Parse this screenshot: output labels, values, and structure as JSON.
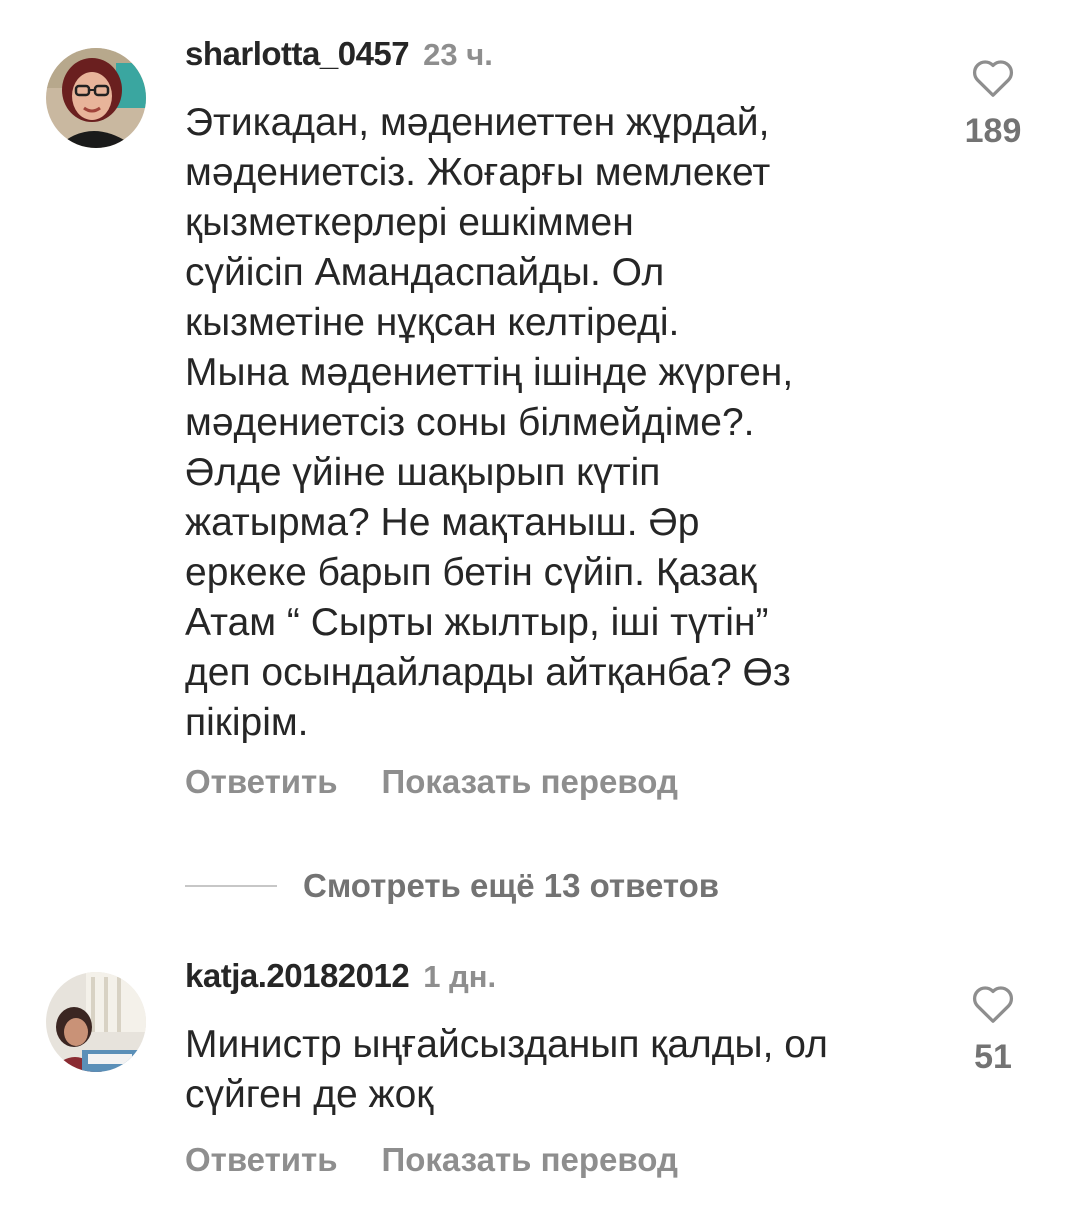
{
  "comments": [
    {
      "username": "sharlotta_0457",
      "time": "23 ч.",
      "text": "Этикадан, мәдениеттен жұрдай,\nмәдениетсіз. Жоғарғы мемлекет\nқызметкерлері ешкіммен\nсүйісіп Амандаспайды. Ол\nкызметіне нұқсан келтіреді.\nМына мәдениеттің ішінде жүрген,\nмәдениетсіз соны білмейдіме?.\nӘлде үйіне шақырып күтіп\nжатырма? Не мақтаныш. Әр\nеркеке барып бетін сүйіп. Қазақ\nАтам “ Сырты жылтыр, іші түтін”\nдеп осындайларды айтқанба? Өз\nпікірім.",
      "likes": "189",
      "reply_label": "Ответить",
      "translate_label": "Показать перевод",
      "avatar_icon": "user-avatar-woman-glasses"
    },
    {
      "username": "katja.20182012",
      "time": "1 дн.",
      "text": "Министр ыңғайсызданып қалды, ол\nсүйген де жоқ",
      "likes": "51",
      "reply_label": "Ответить",
      "translate_label": "Показать перевод",
      "avatar_icon": "user-avatar-woman-desk"
    }
  ],
  "view_more_replies": "Смотреть ещё 13 ответов",
  "icons": {
    "like": "heart-outline-icon"
  },
  "colors": {
    "primary_text": "#262626",
    "secondary_text": "#8e8e8e",
    "divider": "#c7c7c7"
  }
}
